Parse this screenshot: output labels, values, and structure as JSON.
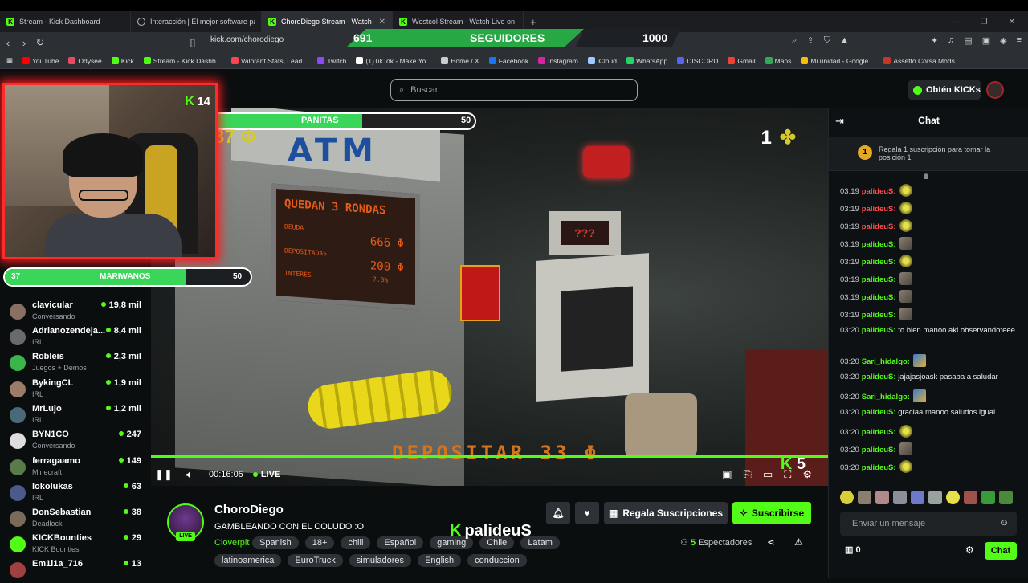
{
  "browser": {
    "tabs": [
      {
        "label": "Stream - Kick Dashboard",
        "active": false
      },
      {
        "label": "Interacción | El mejor software para",
        "active": false
      },
      {
        "label": "ChoroDiego Stream - Watch Live on Kick",
        "active": true
      },
      {
        "label": "Westcol Stream - Watch Live on Kick",
        "active": false
      }
    ],
    "url": "kick.com/chorodiego",
    "bookmarks": [
      "YouTube",
      "Odysee",
      "Kick",
      "Stream - Kick Dashb...",
      "Valorant Stats, Lead...",
      "Twitch",
      "(1)TikTok - Make Yo...",
      "Home / X",
      "Facebook",
      "Instagram",
      "iCloud",
      "WhatsApp",
      "DISCORD",
      "Gmail",
      "Maps",
      "Mi unidad - Google...",
      "Assetto Corsa Mods..."
    ]
  },
  "follower_goal": {
    "current": "691",
    "label": "SEGUIDORES",
    "target": "1000",
    "progress": 0.691
  },
  "search": {
    "placeholder": "Buscar"
  },
  "header": {
    "kicks_label": "Obtén KICKs"
  },
  "webcam": {
    "kick_count": "14"
  },
  "goal_marihuanos": {
    "current": "37",
    "label": "MARIWANOS",
    "target": "50",
    "progress": 0.74
  },
  "goal_panitas": {
    "current": "",
    "label": "PANITAS",
    "target": "50",
    "progress": 0.65
  },
  "sidebar": {
    "channels": [
      {
        "name": "clavicular",
        "category": "Conversando",
        "viewers": "19,8 mil",
        "color": "#8a7060"
      },
      {
        "name": "Adrianozendeja...",
        "category": "IRL",
        "viewers": "8,4 mil",
        "color": "#6a6a6a"
      },
      {
        "name": "Robleis",
        "category": "Juegos + Demos",
        "viewers": "2,3 mil",
        "color": "#3bb54a"
      },
      {
        "name": "BykingCL",
        "category": "IRL",
        "viewers": "1,9 mil",
        "color": "#9b7b6a"
      },
      {
        "name": "MrLujo",
        "category": "IRL",
        "viewers": "1,2 mil",
        "color": "#4a6a7a"
      },
      {
        "name": "BYN1CO",
        "category": "Conversando",
        "viewers": "247",
        "color": "#ddd"
      },
      {
        "name": "ferragaamo",
        "category": "Minecraft",
        "viewers": "149",
        "color": "#5a7a4a"
      },
      {
        "name": "lokolukas",
        "category": "IRL",
        "viewers": "63",
        "color": "#4a5a8a"
      },
      {
        "name": "DonSebastian",
        "category": "Deadlock",
        "viewers": "38",
        "color": "#7a6a5a"
      },
      {
        "name": "KICKBounties",
        "category": "KICK Bounties",
        "viewers": "29",
        "color": "#53fc18"
      },
      {
        "name": "Em1l1a_716",
        "category": "",
        "viewers": "13",
        "color": "#a04040"
      }
    ]
  },
  "video": {
    "atm_text": "ATM",
    "screen_title": "QUEDAN 3 RONDAS",
    "screen_rows": [
      {
        "label": "DEUDA",
        "value": "666 Φ"
      },
      {
        "label": "DEPOSITADAS",
        "value": "200 Φ"
      },
      {
        "label": "INTERES",
        "value": "7.0%"
      }
    ],
    "deposit_text": "DEPOSITAR 33 Φ",
    "score_left": "37 Φ",
    "round_count": "1",
    "question": "???",
    "kick_count_overlay": "5",
    "time": "00:16:05",
    "live_label": "LIVE"
  },
  "stream": {
    "name": "ChoroDiego",
    "title": "GAMBLEANDO CON EL COLUDO :O",
    "game": "Cloverpit",
    "live_badge": "LIVE",
    "tags_row1": [
      "Spanish",
      "18+",
      "chill",
      "Español",
      "gaming",
      "Chile",
      "Latam"
    ],
    "tags_row2": [
      "latinoamerica",
      "EuroTruck",
      "simuladores",
      "English",
      "conduccion"
    ],
    "viewers_count": "5",
    "viewers_label": "Espectadores",
    "gift_label": "Regala Suscripciones",
    "subscribe_label": "Suscribirse",
    "overlay_username": "palideuS"
  },
  "chat": {
    "title": "Chat",
    "banner_rank": "1",
    "banner_text": "Regala 1 suscripción para tomar la posición 1",
    "messages": [
      {
        "time": "03:19",
        "user": "palideuS:",
        "color": "#ff4d4d",
        "text": "",
        "emote": "y"
      },
      {
        "time": "03:19",
        "user": "palideuS:",
        "color": "#ff4d4d",
        "text": "",
        "emote": "y"
      },
      {
        "time": "03:19",
        "user": "palideuS:",
        "color": "#ff4d4d",
        "text": "",
        "emote": "y"
      },
      {
        "time": "03:19",
        "user": "palideuS:",
        "color": "#53fc18",
        "text": "",
        "emote": "p"
      },
      {
        "time": "03:19",
        "user": "palideuS:",
        "color": "#53fc18",
        "text": "",
        "emote": "y"
      },
      {
        "time": "03:19",
        "user": "palideuS:",
        "color": "#53fc18",
        "text": "",
        "emote": "p"
      },
      {
        "time": "03:19",
        "user": "palideuS:",
        "color": "#53fc18",
        "text": "",
        "emote": "p"
      },
      {
        "time": "03:19",
        "user": "palideuS:",
        "color": "#53fc18",
        "text": "",
        "emote": "p"
      },
      {
        "time": "03:20",
        "user": "palideuS:",
        "color": "#53fc18",
        "text": "to bien manoo aki observandoteee",
        "emote": ""
      },
      {
        "time": "03:20",
        "user": "Sari_hidalgo:",
        "color": "#53fc18",
        "text": "",
        "emote": "b"
      },
      {
        "time": "03:20",
        "user": "palideuS:",
        "color": "#53fc18",
        "text": "jajajasjoask pasaba a saludar",
        "emote": ""
      },
      {
        "time": "03:20",
        "user": "Sari_hidalgo:",
        "color": "#53fc18",
        "text": "",
        "emote": "b"
      },
      {
        "time": "03:20",
        "user": "palideuS:",
        "color": "#53fc18",
        "text": "graciaa manoo saludos igual",
        "emote": ""
      },
      {
        "time": "03:20",
        "user": "palideuS:",
        "color": "#53fc18",
        "text": "",
        "emote": "y"
      },
      {
        "time": "03:20",
        "user": "palideuS:",
        "color": "#53fc18",
        "text": "",
        "emote": "p"
      },
      {
        "time": "03:20",
        "user": "palideuS:",
        "color": "#53fc18",
        "text": "",
        "emote": "y"
      }
    ],
    "input_placeholder": "Enviar un mensaje",
    "points": "0",
    "send_label": "Chat"
  }
}
